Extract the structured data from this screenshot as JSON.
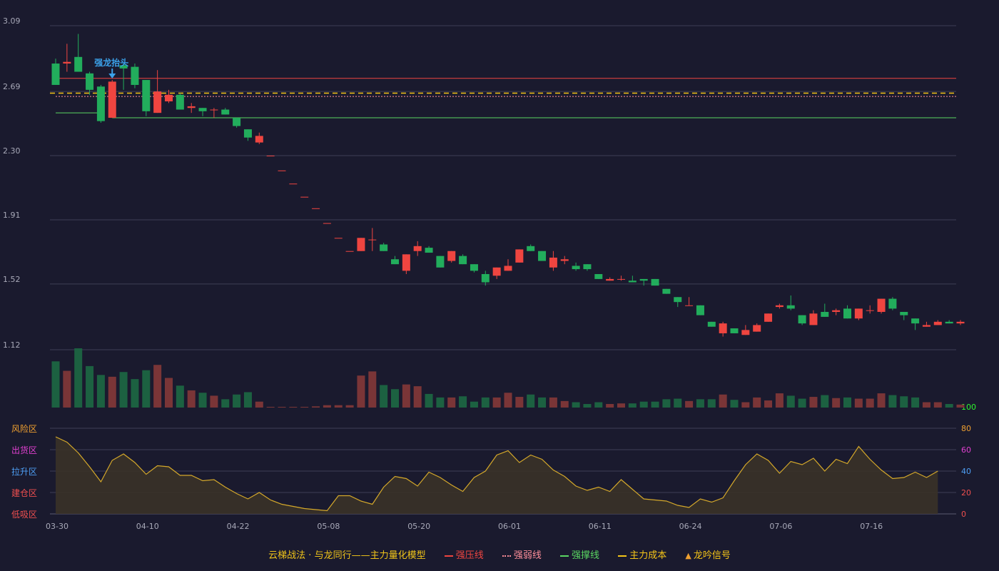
{
  "chart_data": {
    "type": "candlestick",
    "x_tick_labels": [
      "03-30",
      "04-10",
      "04-22",
      "05-08",
      "05-20",
      "06-01",
      "06-11",
      "06-24",
      "07-06",
      "07-16"
    ],
    "x_tick_indices": [
      0,
      8,
      16,
      24,
      32,
      40,
      48,
      56,
      64,
      72
    ],
    "y_price_ticks": [
      "3.09",
      "2.69",
      "2.30",
      "1.91",
      "1.52",
      "1.12"
    ],
    "y_price_values": [
      3.09,
      2.69,
      2.3,
      1.91,
      1.52,
      1.12
    ],
    "price_range": [
      1.12,
      3.09
    ],
    "candles": [
      [
        2.86,
        2.73,
        2.89,
        2.73
      ],
      [
        2.86,
        2.87,
        2.98,
        2.81
      ],
      [
        2.9,
        2.81,
        3.04,
        2.81
      ],
      [
        2.8,
        2.7,
        2.81,
        2.67
      ],
      [
        2.72,
        2.51,
        2.73,
        2.5
      ],
      [
        2.53,
        2.75,
        2.76,
        2.53
      ],
      [
        2.85,
        2.83,
        2.86,
        2.7
      ],
      [
        2.84,
        2.73,
        2.86,
        2.71
      ],
      [
        2.76,
        2.57,
        2.76,
        2.54
      ],
      [
        2.56,
        2.69,
        2.82,
        2.56
      ],
      [
        2.63,
        2.67,
        2.7,
        2.62
      ],
      [
        2.67,
        2.58,
        2.68,
        2.58
      ],
      [
        2.59,
        2.6,
        2.62,
        2.56
      ],
      [
        2.59,
        2.57,
        2.59,
        2.54
      ],
      [
        2.58,
        2.58,
        2.59,
        2.53
      ],
      [
        2.58,
        2.55,
        2.59,
        2.55
      ],
      [
        2.53,
        2.48,
        2.53,
        2.47
      ],
      [
        2.46,
        2.41,
        2.46,
        2.39
      ],
      [
        2.38,
        2.42,
        2.44,
        2.37
      ],
      [
        2.3,
        2.3,
        2.3,
        2.3
      ],
      [
        2.21,
        2.21,
        2.21,
        2.21
      ],
      [
        2.13,
        2.13,
        2.13,
        2.13
      ],
      [
        2.05,
        2.05,
        2.05,
        2.05
      ],
      [
        1.98,
        1.98,
        1.98,
        1.98
      ],
      [
        1.89,
        1.89,
        1.89,
        1.89
      ],
      [
        1.8,
        1.8,
        1.8,
        1.8
      ],
      [
        1.72,
        1.72,
        1.72,
        1.72
      ],
      [
        1.72,
        1.8,
        1.8,
        1.72
      ],
      [
        1.79,
        1.79,
        1.86,
        1.72
      ],
      [
        1.76,
        1.72,
        1.77,
        1.72
      ],
      [
        1.67,
        1.64,
        1.69,
        1.64
      ],
      [
        1.6,
        1.7,
        1.7,
        1.58
      ],
      [
        1.72,
        1.75,
        1.78,
        1.69
      ],
      [
        1.74,
        1.71,
        1.75,
        1.71
      ],
      [
        1.69,
        1.62,
        1.69,
        1.62
      ],
      [
        1.66,
        1.72,
        1.72,
        1.65
      ],
      [
        1.69,
        1.64,
        1.7,
        1.64
      ],
      [
        1.64,
        1.6,
        1.64,
        1.59
      ],
      [
        1.58,
        1.53,
        1.6,
        1.51
      ],
      [
        1.57,
        1.62,
        1.62,
        1.55
      ],
      [
        1.6,
        1.63,
        1.67,
        1.6
      ],
      [
        1.65,
        1.73,
        1.73,
        1.65
      ],
      [
        1.75,
        1.72,
        1.76,
        1.72
      ],
      [
        1.72,
        1.66,
        1.72,
        1.66
      ],
      [
        1.62,
        1.68,
        1.72,
        1.6
      ],
      [
        1.66,
        1.67,
        1.69,
        1.64
      ],
      [
        1.63,
        1.61,
        1.65,
        1.6
      ],
      [
        1.64,
        1.61,
        1.64,
        1.6
      ],
      [
        1.58,
        1.55,
        1.58,
        1.55
      ],
      [
        1.54,
        1.55,
        1.56,
        1.54
      ],
      [
        1.55,
        1.55,
        1.57,
        1.54
      ],
      [
        1.54,
        1.53,
        1.57,
        1.53
      ],
      [
        1.55,
        1.54,
        1.55,
        1.51
      ],
      [
        1.55,
        1.51,
        1.55,
        1.51
      ],
      [
        1.49,
        1.46,
        1.49,
        1.46
      ],
      [
        1.44,
        1.41,
        1.44,
        1.38
      ],
      [
        1.39,
        1.39,
        1.44,
        1.39
      ],
      [
        1.39,
        1.33,
        1.39,
        1.33
      ],
      [
        1.29,
        1.26,
        1.29,
        1.26
      ],
      [
        1.22,
        1.28,
        1.29,
        1.2
      ],
      [
        1.25,
        1.22,
        1.25,
        1.22
      ],
      [
        1.21,
        1.24,
        1.27,
        1.21
      ],
      [
        1.23,
        1.27,
        1.28,
        1.23
      ],
      [
        1.29,
        1.34,
        1.34,
        1.29
      ],
      [
        1.38,
        1.39,
        1.4,
        1.37
      ],
      [
        1.39,
        1.37,
        1.45,
        1.36
      ],
      [
        1.33,
        1.28,
        1.33,
        1.27
      ],
      [
        1.27,
        1.34,
        1.36,
        1.27
      ],
      [
        1.35,
        1.32,
        1.4,
        1.32
      ],
      [
        1.35,
        1.36,
        1.37,
        1.33
      ],
      [
        1.37,
        1.31,
        1.39,
        1.31
      ],
      [
        1.31,
        1.37,
        1.37,
        1.3
      ],
      [
        1.36,
        1.36,
        1.39,
        1.34
      ],
      [
        1.35,
        1.43,
        1.43,
        1.34
      ],
      [
        1.43,
        1.37,
        1.44,
        1.36
      ],
      [
        1.35,
        1.33,
        1.35,
        1.3
      ],
      [
        1.31,
        1.28,
        1.31,
        1.24
      ],
      [
        1.26,
        1.27,
        1.29,
        1.26
      ],
      [
        1.27,
        1.29,
        1.3,
        1.27
      ],
      [
        1.29,
        1.28,
        1.3,
        1.28
      ],
      [
        1.28,
        1.29,
        1.3,
        1.27
      ]
    ],
    "volume": [
      78,
      62,
      100,
      70,
      55,
      52,
      60,
      48,
      63,
      72,
      50,
      37,
      29,
      25,
      20,
      14,
      22,
      26,
      10,
      1,
      1,
      1,
      1,
      2,
      4,
      4,
      4,
      54,
      61,
      38,
      31,
      39,
      36,
      23,
      17,
      17,
      19,
      10,
      17,
      17,
      25,
      18,
      22,
      17,
      17,
      11,
      9,
      6,
      9,
      6,
      7,
      7,
      10,
      10,
      14,
      15,
      11,
      14,
      14,
      22,
      13,
      9,
      17,
      12,
      24,
      20,
      15,
      18,
      21,
      16,
      17,
      15,
      15,
      24,
      21,
      19,
      17,
      9,
      9,
      6,
      5
    ],
    "indicator_values": [
      72,
      67,
      57,
      44,
      30,
      50,
      56,
      48,
      37,
      45,
      44,
      36,
      36,
      31,
      32,
      25,
      19,
      14,
      20,
      13,
      9,
      7,
      5,
      4,
      3,
      17,
      17,
      12,
      9,
      25,
      35,
      33,
      26,
      39,
      34,
      27,
      21,
      34,
      40,
      55,
      59,
      48,
      55,
      51,
      41,
      35,
      26,
      22,
      25,
      21,
      32,
      23,
      14,
      13,
      12,
      8,
      6,
      14,
      11,
      15,
      31,
      46,
      56,
      50,
      38,
      49,
      46,
      52,
      40,
      51,
      47,
      63,
      51,
      41,
      33,
      34,
      39,
      34,
      40
    ],
    "indicator_axis_ticks": [
      "100",
      "80",
      "60",
      "40",
      "20",
      "0"
    ],
    "indicator_axis_values": [
      100,
      80,
      60,
      40,
      20,
      0
    ],
    "zones": [
      "风险区",
      "出货区",
      "拉升区",
      "建仓区",
      "低吸区"
    ],
    "zone_values": [
      80,
      60,
      40,
      20,
      0
    ],
    "resistance_line": {
      "name": "强压线",
      "value": 2.77,
      "from_index": 0
    },
    "weak_line": {
      "name": "强弱线",
      "value": 2.66,
      "from_index": 0
    },
    "support_line": {
      "name": "强撑线",
      "segments": [
        {
          "value": 2.56,
          "from_index": 0,
          "to_index": 4
        },
        {
          "value": 2.53,
          "from_index": 5,
          "to_index": 80
        }
      ]
    },
    "main_cost_line": {
      "name": "主力成本",
      "value": 2.68
    },
    "signal": {
      "name": "龙吟信号",
      "annotation": "强龙抬头",
      "index": 5
    },
    "colors": {
      "background": "#1a1a2e",
      "up": "#ef4540",
      "down": "#22ad5c",
      "up_volume": "#7a3537",
      "down_volume": "#1c6141",
      "resistance": "#ef4540",
      "weak": "#ff8f9a",
      "support": "#5ad662",
      "cost": "#f5c518",
      "indicator_line": "#d4a82a",
      "indicator_fill": "#3a3228",
      "signal": "#3ba2ea",
      "grid": "#3e3f55",
      "axis_text": "#a8a9b8"
    }
  },
  "zone_colors": [
    "#f0a030",
    "#e040d0",
    "#4e9ff5",
    "#ef4f4f",
    "#ef4f4f"
  ],
  "axis_right_colors": [
    "#2ff52f",
    "#f0a030",
    "#e040d0",
    "#4e9ff5",
    "#ef4f4f",
    "#ef4f4f"
  ],
  "legend": {
    "title": "云梯战法 · 与龙同行——主力量化模型",
    "resistance": "强压线",
    "weak": "强弱线",
    "support": "强撑线",
    "cost": "主力成本",
    "signal": "龙吟信号",
    "signal_glyph": "▲"
  }
}
